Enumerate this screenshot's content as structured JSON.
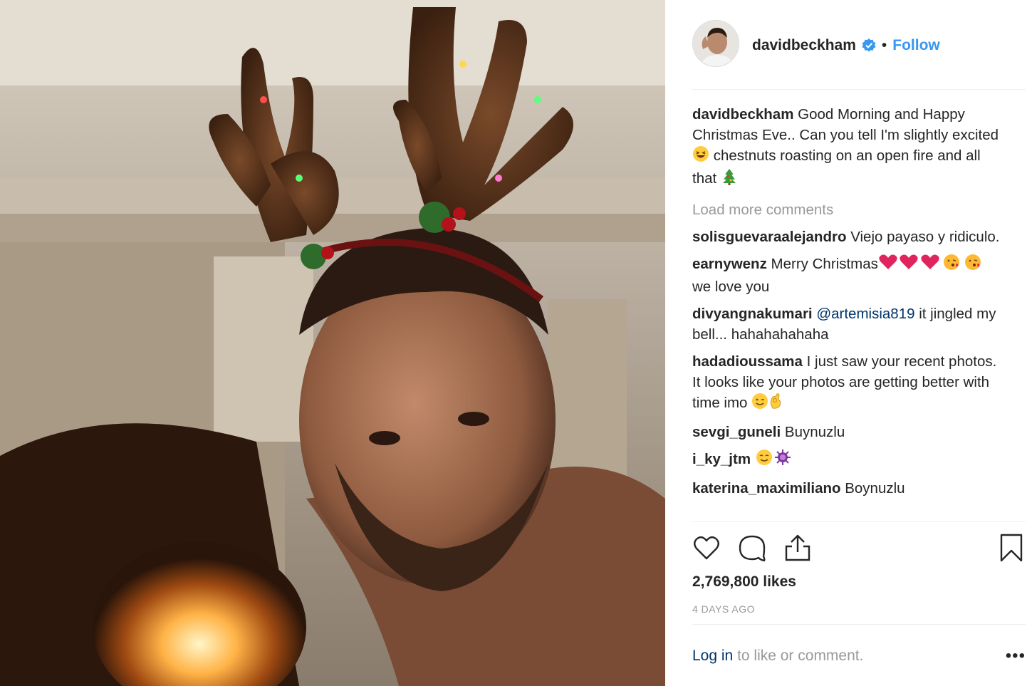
{
  "post": {
    "photo_alt": "Selfie with reindeer antler headband by a fireplace"
  },
  "header": {
    "username": "davidbeckham",
    "separator": "•",
    "follow_label": "Follow"
  },
  "caption": {
    "user": "davidbeckham",
    "line": "Good Morning and Happy Christmas Eve.. Can you tell I'm slightly excited",
    "line2": "chestnuts roasting on an open fire and all that"
  },
  "load_more": "Load more comments",
  "comments": [
    {
      "user": "solisguevaraalejandro",
      "text": "Viejo payaso y ridiculo."
    },
    {
      "user": "earnywenz",
      "text": "Merry Christmas",
      "text2": "we love you"
    },
    {
      "user": "divyangnakumari",
      "mention": "@artemisia819",
      "text": "it jingled my bell... hahahahahaha"
    },
    {
      "user": "hadadioussama",
      "text": "I just saw your recent photos. It looks like your photos are getting better with time imo"
    },
    {
      "user": "sevgi_guneli",
      "text": "Buynuzlu"
    },
    {
      "user": "i_ky_jtm",
      "text": ""
    },
    {
      "user": "katerina_maximiliano",
      "text": "Boynuzlu"
    }
  ],
  "likes": "2,769,800 likes",
  "time_ago": "4 DAYS AGO",
  "footer": {
    "login_link": "Log in",
    "login_rest": "to like or comment.",
    "more_label": "•••"
  },
  "colors": {
    "link": "#3897f0",
    "mention": "#003569",
    "muted": "#999999",
    "text": "#262626"
  },
  "icons": [
    "heart-icon",
    "comment-icon",
    "share-icon",
    "bookmark-icon",
    "verified-badge-icon"
  ]
}
